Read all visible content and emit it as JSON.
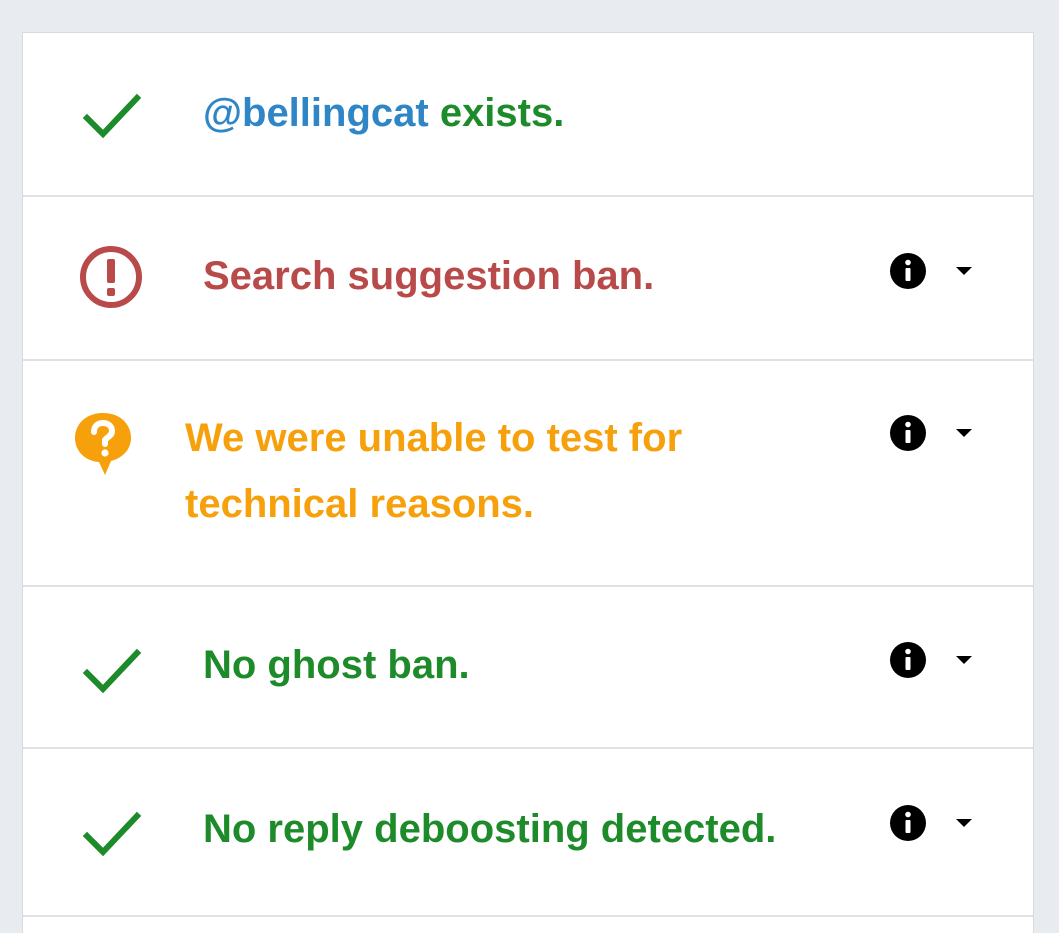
{
  "colors": {
    "pass": "#1e8b2b",
    "fail": "#b84a4a",
    "unknown": "#f6a10c",
    "handle": "#2f86c7",
    "page_background": "#e8ecf0"
  },
  "results": [
    {
      "status": "pass",
      "icon": "check-icon",
      "handle": "@bellingcat",
      "text": " exists."
    },
    {
      "status": "fail",
      "icon": "exclamation-circle-icon",
      "text": "Search suggestion ban.",
      "has_details": true
    },
    {
      "status": "unknown",
      "icon": "question-bubble-icon",
      "text_line1": "We were unable to test for",
      "text_line2": "technical reasons.",
      "has_details": true
    },
    {
      "status": "pass",
      "icon": "check-icon",
      "text": "No ghost ban.",
      "has_details": true
    },
    {
      "status": "pass",
      "icon": "check-icon",
      "text": "No reply deboosting detected.",
      "has_details": true
    }
  ]
}
